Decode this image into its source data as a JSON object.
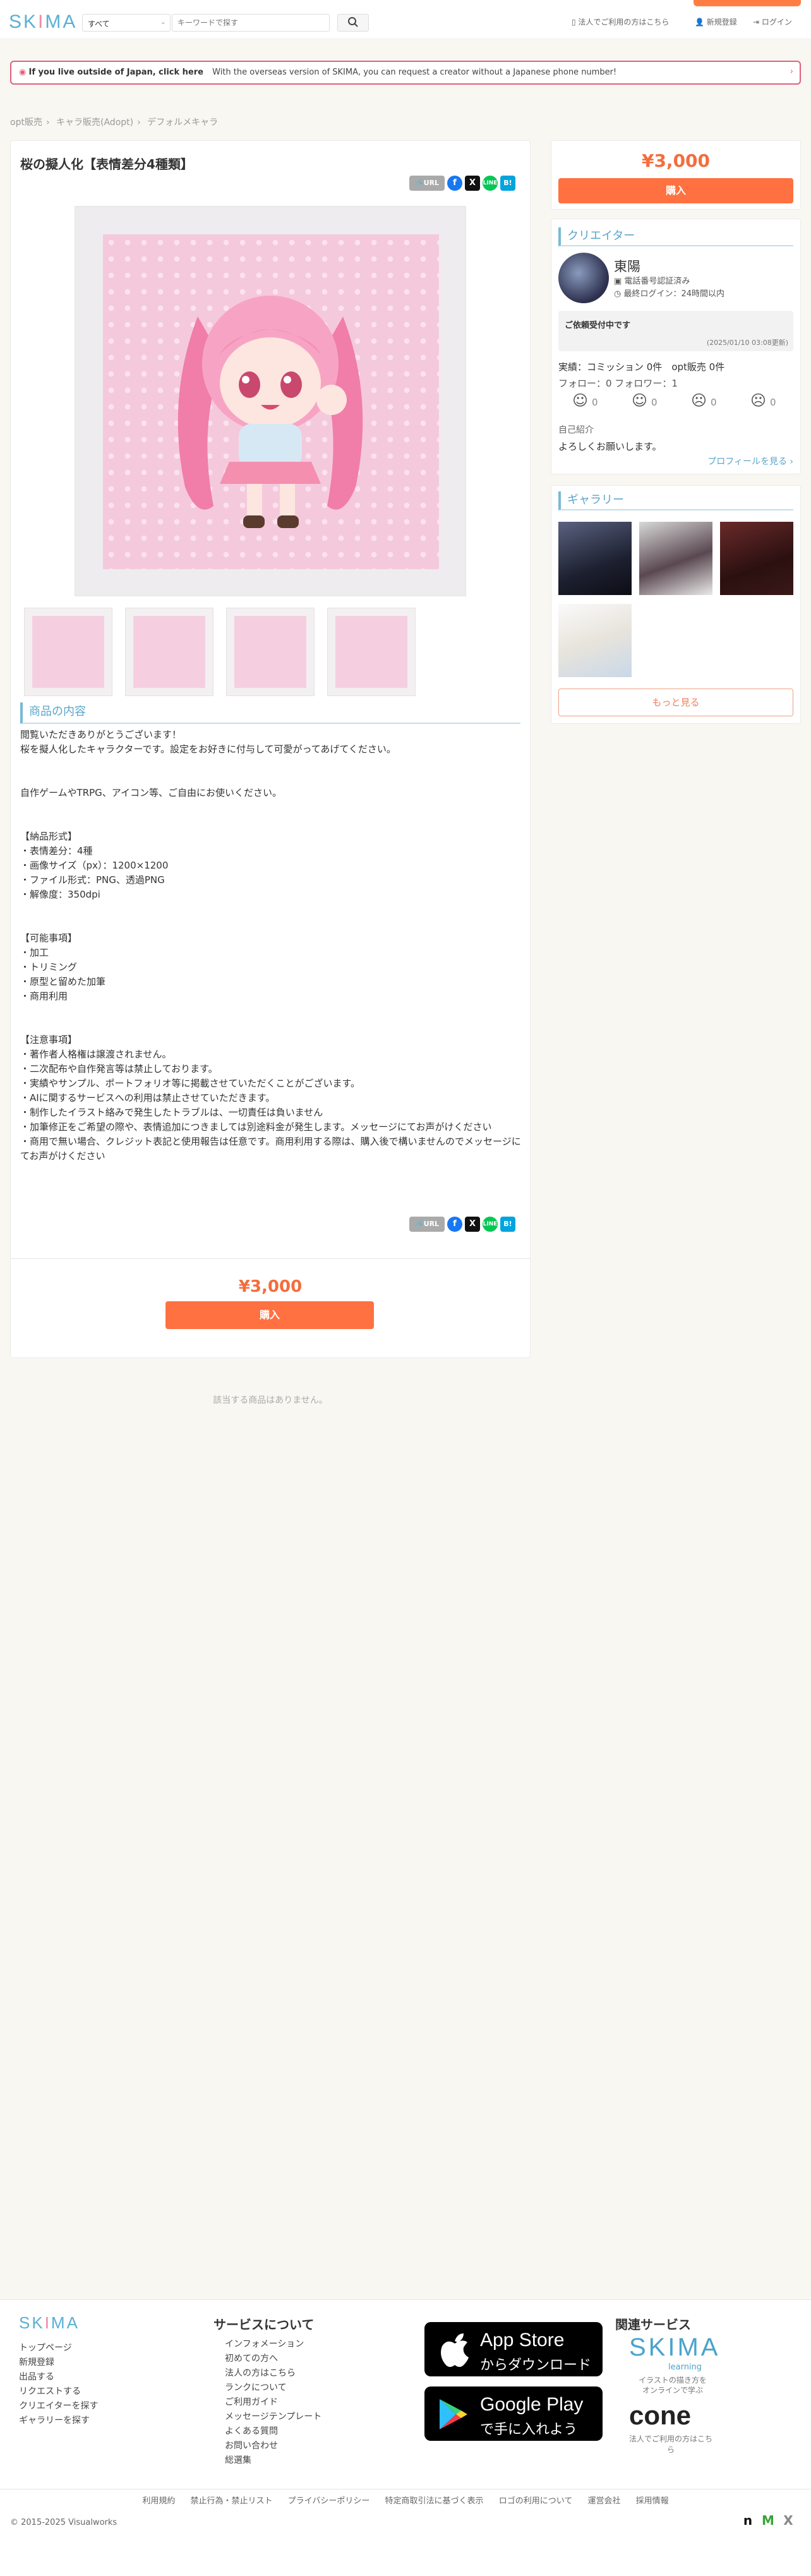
{
  "header": {
    "logo": "SKIMA",
    "category_select": "すべて",
    "search_placeholder": "キーワードで探す",
    "links": [
      "法人でご利用の方はこちら",
      "新規登録",
      "ログイン"
    ]
  },
  "banner": {
    "bold": "If you live outside of Japan, click here",
    "message": "With the overseas version of SKIMA, you can request a creator without a Japanese phone number!"
  },
  "breadcrumb": [
    "opt販売",
    "キャラ販売(Adopt)",
    "デフォルメキャラ"
  ],
  "product": {
    "title": "桜の擬人化【表情差分4種類】",
    "price": "¥3,000",
    "buy_label": "購入",
    "section_heading": "商品の内容",
    "url_label": "URL",
    "description": "閲覧いただきありがとうございます！\n桜を擬人化したキャラクターです。設定をお好きに付与して可愛がってあげてください。\n\n\n自作ゲームやTRPG、アイコン等、ご自由にお使いください。\n\n\n【納品形式】\n・表情差分：4種\n・画像サイズ（px）：1200×1200\n・ファイル形式：PNG、透過PNG\n・解像度：350dpi\n\n\n【可能事項】\n・加工\n・トリミング\n・原型と留めた加筆\n・商用利用\n\n\n【注意事項】\n・著作者人格権は譲渡されません。\n・二次配布や自作発言等は禁止しております。\n・実績やサンプル、ポートフォリオ等に掲載させていただくことがございます。\n・AIに関するサービスへの利用は禁止させていただきます。\n・制作したイラスト絡みで発生したトラブルは、一切責任は負いません\n・加筆修正をご希望の際や、表情追加につきましては別途料金が発生します。メッセージにてお声がけください\n・商用で無い場合、クレジット表記と使用報告は任意です。商用利用する際は、購入後で構いませんのでメッセージにてお声がけください",
    "no_items": "該当する商品はありません。"
  },
  "creator": {
    "heading": "クリエイター",
    "name": "東陽",
    "verified": "電話番号認証済み",
    "last_login": "最終ログイン：24時間以内",
    "request_status": "ご依頼受付中です",
    "request_date": "(2025/01/10 03:08更新)",
    "stats": "実績：コミッション 0件　opt販売 0件",
    "follow": "フォロー：0 フォロワー：1",
    "ratings": [
      "0",
      "0",
      "0",
      "0"
    ],
    "intro_heading": "自己紹介",
    "intro": "よろしくお願いします。",
    "profile_link": "プロフィールを見る ›"
  },
  "gallery": {
    "heading": "ギャラリー",
    "more": "もっと見る"
  },
  "footer": {
    "logo": "SKIMA",
    "links": [
      "トップページ",
      "新規登録",
      "出品する",
      "リクエストする",
      "クリエイターを探す",
      "ギャラリーを探す"
    ],
    "service_heading": "サービスについて",
    "service_links": [
      "インフォメーション",
      "初めての方へ",
      "法人の方はこちら",
      "ランクについて",
      "ご利用ガイド",
      "メッセージテンプレート",
      "よくある質問",
      "お問い合わせ",
      "総選集"
    ],
    "appstore_1": "App Store",
    "appstore_2": "からダウンロード",
    "googleplay_1": "Google Play",
    "googleplay_2": "で手に入れよう",
    "related_heading": "関連サービス",
    "skima_learning": "SKIMA",
    "skima_learning_sub": "learning",
    "skima_learning_cap": "イラストの描き方を オンラインで学ぶ",
    "cone": "cone",
    "cone_cap": "法人でご利用の方はこちら",
    "legal": [
      "利用規約",
      "禁止行為・禁止リスト",
      "プライバシーポリシー",
      "特定商取引法に基づく表示",
      "ロゴの利用について",
      "運営会社",
      "採用情報"
    ],
    "copyright": "© 2015-2025 Visualworks"
  }
}
